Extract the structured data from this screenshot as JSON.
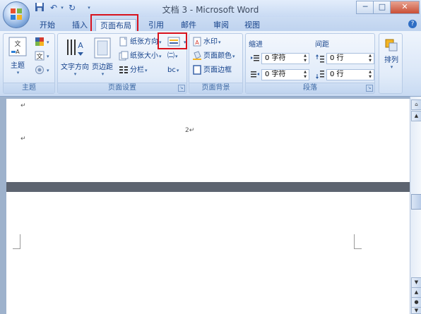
{
  "window": {
    "title": "文档 3 - Microsoft Word",
    "minimize": "─",
    "maximize": "□",
    "close": "✕"
  },
  "quick_access": {
    "save_icon": "save-icon",
    "undo_icon": "undo-icon",
    "redo_icon": "redo-icon"
  },
  "tabs": [
    {
      "label": "开始",
      "active": false
    },
    {
      "label": "插入",
      "active": false
    },
    {
      "label": "页面布局",
      "active": true
    },
    {
      "label": "引用",
      "active": false
    },
    {
      "label": "邮件",
      "active": false
    },
    {
      "label": "审阅",
      "active": false
    },
    {
      "label": "视图",
      "active": false
    }
  ],
  "help": "?",
  "ribbon": {
    "themes_group": {
      "label": "主题",
      "themes_button": "主题"
    },
    "page_setup_group": {
      "label": "页面设置",
      "text_direction": "文字方向",
      "margins": "页边距",
      "orientation": "纸张方向",
      "size": "纸张大小",
      "columns": "分栏",
      "breaks_glyph": "㈡",
      "hyphenation_glyph": "bc"
    },
    "page_background_group": {
      "label": "页面背景",
      "watermark": "水印",
      "page_color": "页面颜色",
      "page_borders": "页面边框"
    },
    "paragraph_group": {
      "label": "段落",
      "indent_label": "缩进",
      "spacing_label": "间距",
      "indent_left": "0 字符",
      "indent_right": "0 字符",
      "spacing_before": "0 行",
      "spacing_after": "0 行"
    },
    "arrange_group": {
      "arrange": "排列"
    }
  },
  "document": {
    "page_number": "2↵",
    "para_mark": "↵"
  },
  "colors": {
    "accent_blue": "#15428b",
    "highlight_red": "#d8121d"
  }
}
